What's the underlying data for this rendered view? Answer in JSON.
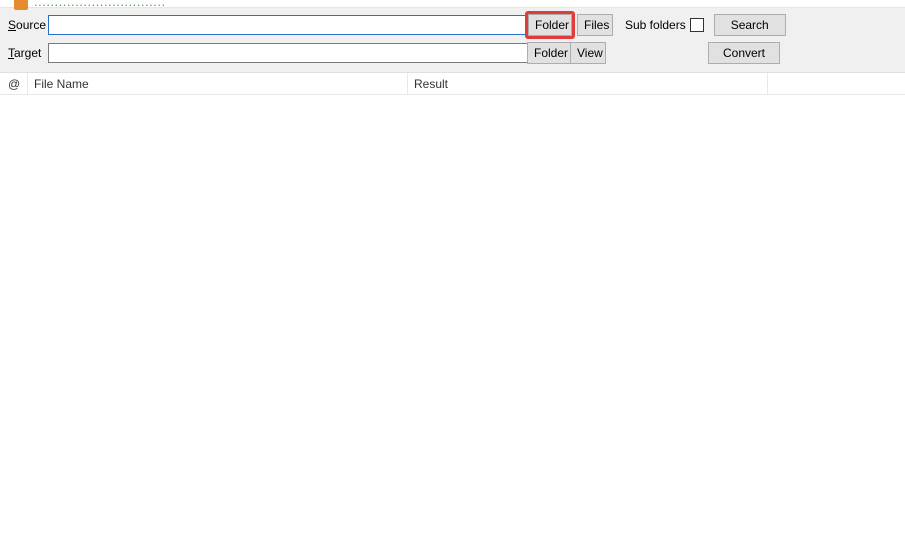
{
  "titlebar": {
    "text": "................................"
  },
  "form": {
    "source_label_prefix": "S",
    "source_label_rest": "ource",
    "target_label_prefix": "T",
    "target_label_rest": "arget",
    "source_value": "",
    "target_value": "",
    "folder_btn": "Folder",
    "files_btn": "Files",
    "view_btn": "View",
    "subfolders_label": "Sub folders",
    "subfolders_checked": false,
    "search_btn": "Search",
    "convert_btn": "Convert"
  },
  "table": {
    "col_at": "@",
    "col_filename": "File Name",
    "col_result": "Result",
    "rows": []
  }
}
